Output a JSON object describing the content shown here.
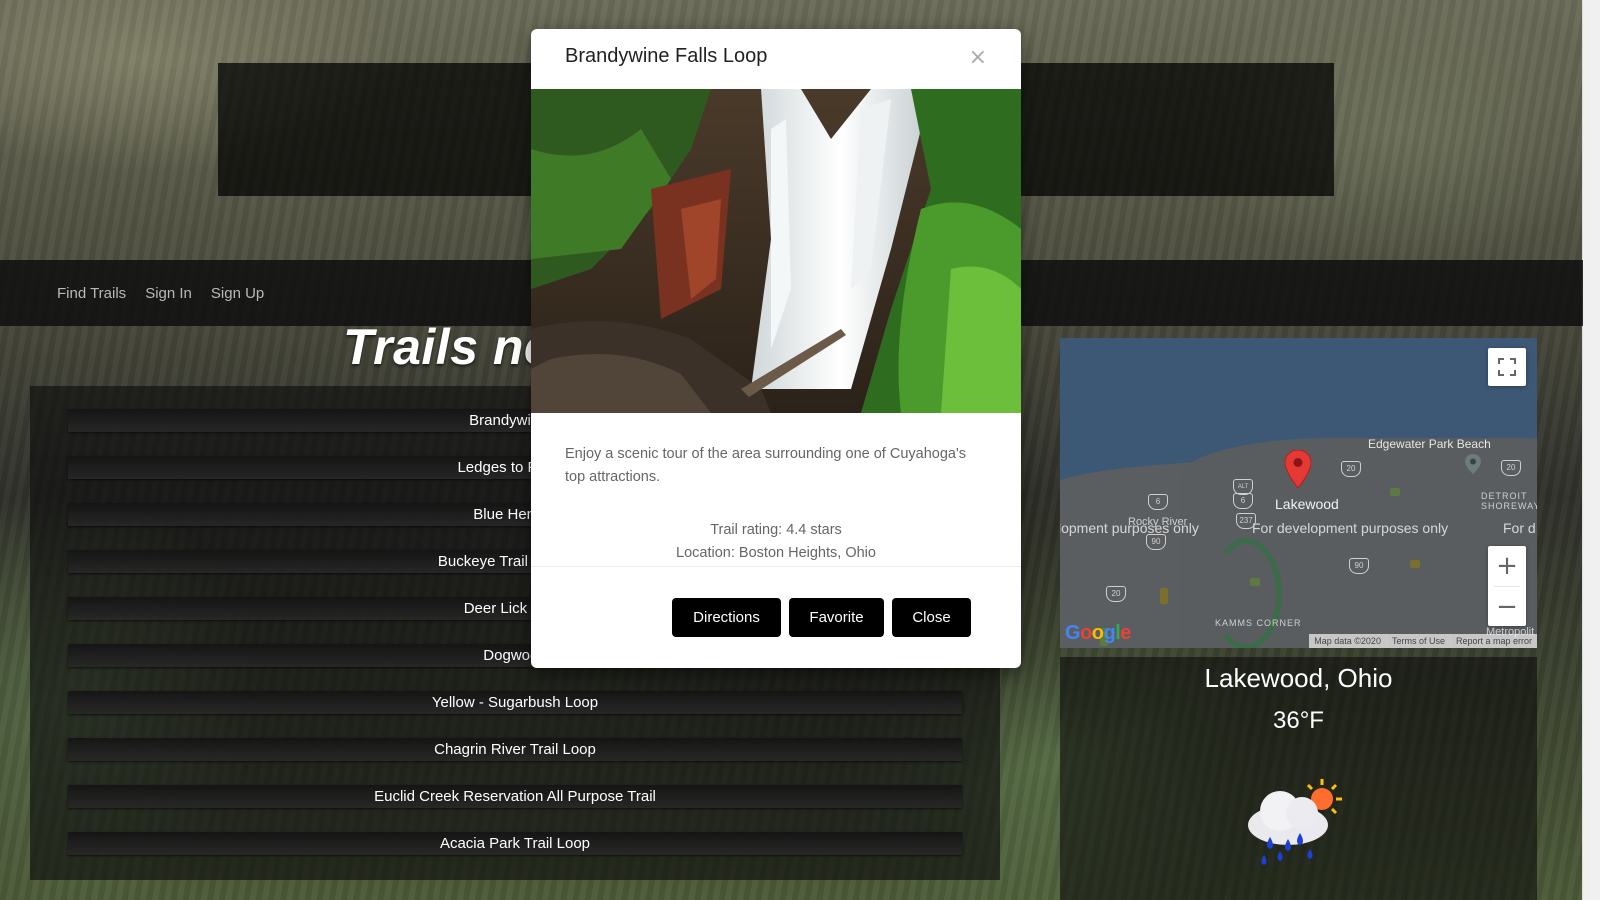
{
  "nav": {
    "links": [
      "Find Trails",
      "Sign In",
      "Sign Up"
    ]
  },
  "page": {
    "heading": "Trails ne"
  },
  "trails": [
    "Brandywine F",
    "Ledges to Pine C",
    "Blue Hen Fa",
    "Buckeye Trail - Cuyahc",
    "Deer Lick Cave",
    "Dogwood",
    "Yellow - Sugarbush Loop",
    "Chagrin River Trail Loop",
    "Euclid Creek Reservation All Purpose Trail",
    "Acacia Park Trail Loop"
  ],
  "modal": {
    "title": "Brandywine Falls Loop",
    "close_icon": "×",
    "description": "Enjoy a scenic tour of the area surrounding one of Cuyahoga's top attractions.",
    "rating": "Trail rating: 4.4 stars",
    "location": "Location: Boston Heights, Ohio",
    "buttons": {
      "directions": "Directions",
      "favorite": "Favorite",
      "close": "Close"
    }
  },
  "map": {
    "labels": {
      "edgewater": "Edgewater Park Beach",
      "lakewood": "Lakewood",
      "dev1": "lopment purposes only",
      "dev2": "For development purposes only",
      "dev3": "For d",
      "rocky_river": "Rocky River",
      "kamms": "KAMMS CORNER",
      "detroit": "DETROIT",
      "shoreway": "SHOREWAY",
      "metro": "Metropolit"
    },
    "shields": [
      "20",
      "20",
      "6",
      "6",
      "ALT",
      "237",
      "90",
      "90",
      "20"
    ],
    "zoom_in": "+",
    "zoom_out": "−",
    "logo": "Google",
    "footer": [
      "Map data ©2020",
      "Terms of Use",
      "Report a map error"
    ],
    "colors": {
      "water": "#3d5874",
      "land": "#5b5e60",
      "pin": "#e53935"
    }
  },
  "weather": {
    "city": "Lakewood, Ohio",
    "temperature": "36°F",
    "icon": "rain-sun-cloud-icon"
  }
}
